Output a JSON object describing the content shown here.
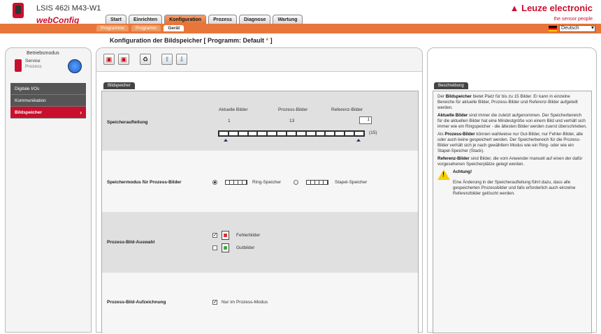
{
  "header": {
    "device_title": "LSIS 462i M43-W1",
    "brand": "webConfig",
    "company": "Leuze electronic",
    "tagline": "the sensor people",
    "language": "Deutsch"
  },
  "tabs": [
    "Start",
    "Einrichten",
    "Konfiguration",
    "Prozess",
    "Diagnose",
    "Wartung"
  ],
  "subtabs": [
    "Programme",
    "Programm",
    "Gerät"
  ],
  "page_title": "Konfiguration der Bildspeicher   [ Programm: Default",
  "page_title_star": "*",
  "page_title_end": " ]",
  "mode": {
    "label": "Betriebsmodus",
    "service": "Service",
    "process": "Prozess"
  },
  "nav": [
    "Digitale I/Os",
    "Kommunikation",
    "Bildspeicher"
  ],
  "section_tab": "Bildspeicher",
  "memory": {
    "row_label": "Speicheraufteilung",
    "col_current": "Aktuelle Bilder",
    "col_process": "Prozess-Bilder",
    "col_reference": "Referenz-Bilder",
    "current_val": "1",
    "process_val": "13",
    "reference_val": "1",
    "total": "(15)"
  },
  "mode_row": {
    "label": "Speichermodus für Prozess-Bilder",
    "ring": "Ring-Speicher",
    "stack": "Stapel-Speicher"
  },
  "selection": {
    "label": "Prozess-Bild-Auswahl",
    "fail": "Fehlerbilder",
    "good": "Gutbilder"
  },
  "recording": {
    "label": "Prozess-Bild-Aufzeichnung",
    "option": "Nur im Prozess-Modus"
  },
  "description": {
    "tab": "Beschreibung",
    "p1_b": "Bildspeicher",
    "p1_pre": "Der ",
    "p1": " bietet Platz für bis zu 15 Bilder. Er kann in einzelne Bereiche für aktuelle Bilder, Prozess-Bilder und Referenz-Bilder aufgeteilt werden.",
    "p2_b": "Aktuelle Bilder",
    "p2": " sind immer die zuletzt aufgenommen. Der Speicherbereich für die aktuellen Bilder hat eine Mindestgröße von einem Bild und verhält sich immer wie ein Ringspeicher - die ältesten Bilder werden zuerst überschrieben.",
    "p3_pre": "Als ",
    "p3_b": "Prozess-Bilder",
    "p3": " können wahlweise nur Gut-Bilder, nur Fehler-Bilder, alle oder auch keine gespeichert werden. Der Speicherbereich für die Prozess-Bilder verhält sich je nach gewähltem Modus wie ein Ring- oder wie ein Stapel-Speicher (Stack).",
    "p4_b": "Referenz-Bilder",
    "p4": " sind Bilder, die vom Anwender manuell auf einen der dafür vorgesehenen Speicherplätze gelegt werden.",
    "warn_title": "Achtung!",
    "warn_text": "Eine Änderung in der Speicheraufteilung führt dazu, dass alle gespeicherten Prozessbilder und falls erforderlich auch einzelne Referenzbilder gelöscht werden."
  }
}
